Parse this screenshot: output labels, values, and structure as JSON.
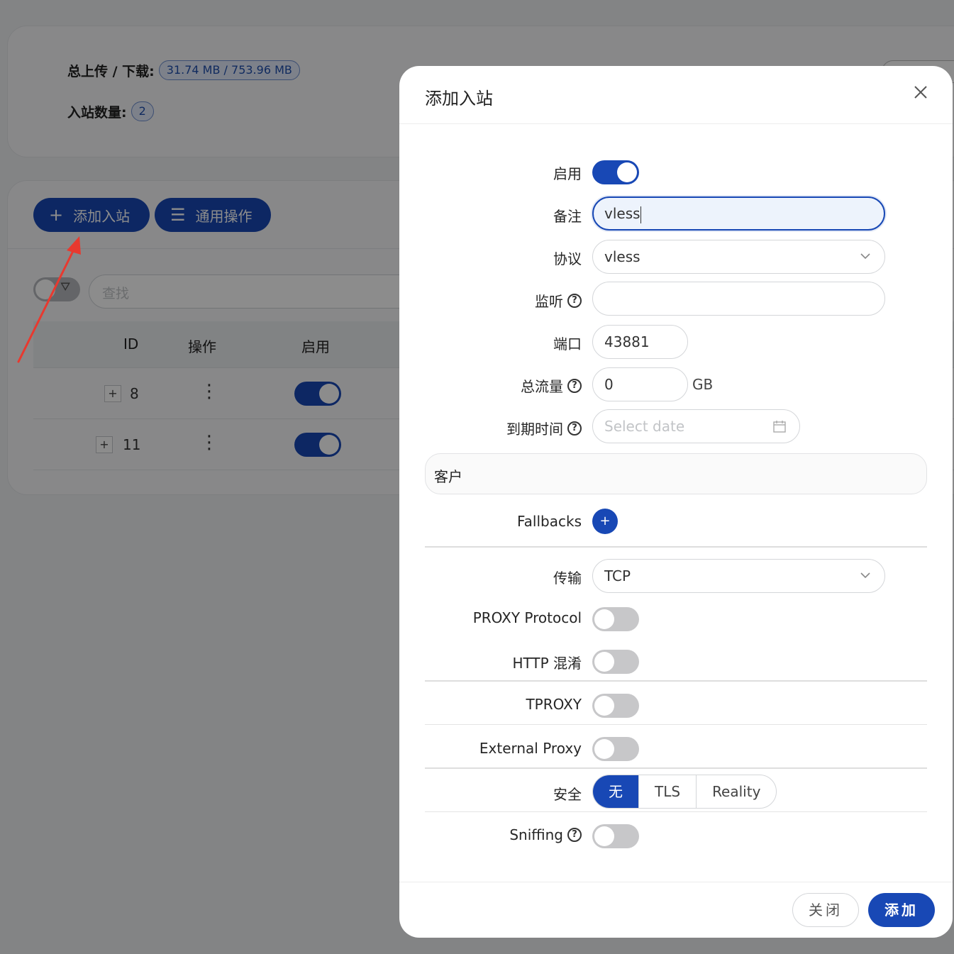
{
  "stats": {
    "traffic_label": "总上传 / 下载:",
    "traffic_value": "31.74 MB / 753.96 MB",
    "inbound_count_label": "入站数量:",
    "inbound_count_value": "2"
  },
  "toolbar": {
    "add_inbound_label": "添加入站",
    "general_actions_label": "通用操作"
  },
  "search": {
    "placeholder": "查找"
  },
  "table": {
    "columns": [
      "ID",
      "操作",
      "启用"
    ],
    "rows": [
      {
        "id": "8",
        "enabled": true
      },
      {
        "id": "11",
        "enabled": true
      }
    ]
  },
  "modal": {
    "title": "添加入站",
    "fields": {
      "enable_label": "启用",
      "enable_value": true,
      "remark_label": "备注",
      "remark_value": "vless",
      "protocol_label": "协议",
      "protocol_value": "vless",
      "listen_label": "监听",
      "listen_value": "",
      "port_label": "端口",
      "port_value": "43881",
      "total_traffic_label": "总流量",
      "total_traffic_value": "0",
      "total_traffic_unit": "GB",
      "expiry_label": "到期时间",
      "expiry_placeholder": "Select date",
      "clients_label": "客户",
      "fallbacks_label": "Fallbacks",
      "fallbacks_add": "+",
      "transport_label": "传输",
      "transport_value": "TCP",
      "proxy_protocol_label": "PROXY Protocol",
      "http_obfs_label": "HTTP 混淆",
      "tproxy_label": "TPROXY",
      "external_proxy_label": "External Proxy",
      "security_label": "安全",
      "security_options": [
        "无",
        "TLS",
        "Reality"
      ],
      "security_selected": "无",
      "sniffing_label": "Sniffing"
    },
    "footer": {
      "close_label": "关闭",
      "add_label": "添加"
    }
  },
  "colors": {
    "primary": "#1848b5",
    "overlay": "rgba(0,0,0,0.45)",
    "annotation_arrow": "#e8392f"
  }
}
